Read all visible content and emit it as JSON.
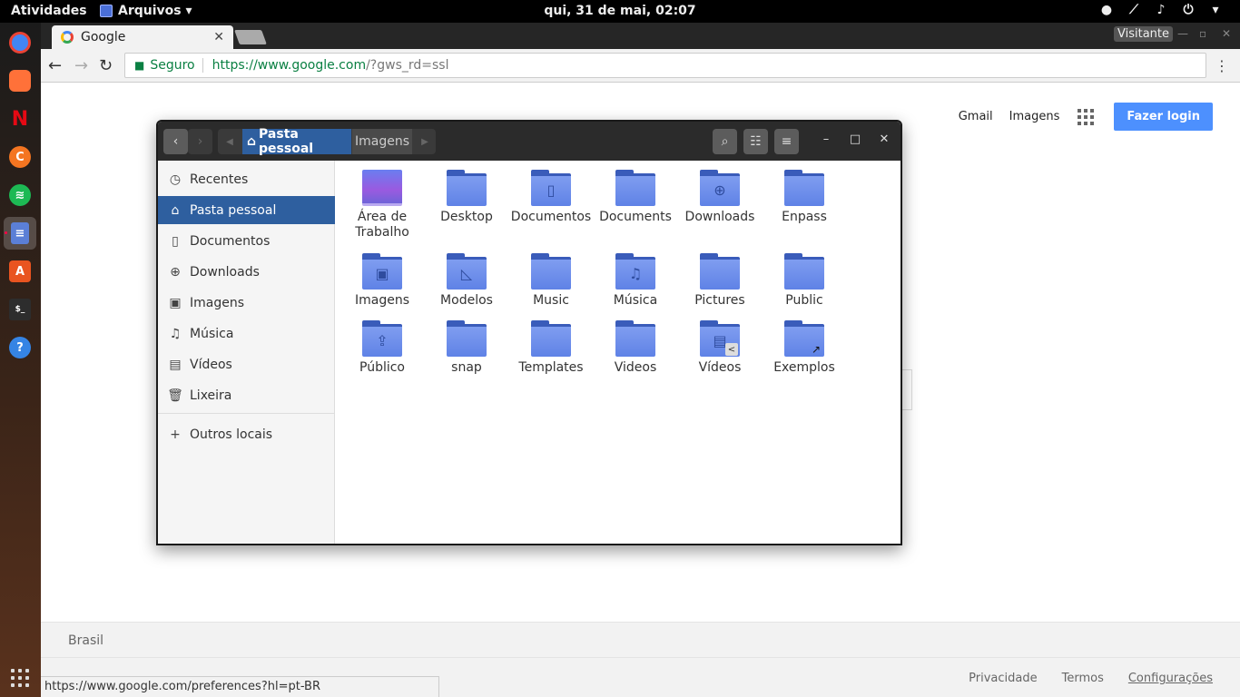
{
  "topbar": {
    "activities": "Atividades",
    "app_menu": "Arquivos ▾",
    "clock": "qui, 31 de mai, 02:07"
  },
  "dock": {
    "apps": [
      {
        "name": "chrome-icon",
        "color": "#4285f4"
      },
      {
        "name": "firefox-icon",
        "color": "#ff7139"
      },
      {
        "name": "netflix-icon",
        "color": "#e50914"
      },
      {
        "name": "crunchyroll-icon",
        "color": "#f47521"
      },
      {
        "name": "spotify-icon",
        "color": "#1db954"
      },
      {
        "name": "files-icon",
        "color": "#5b7fd6"
      },
      {
        "name": "software-center-icon",
        "color": "#e95420"
      },
      {
        "name": "terminal-icon",
        "color": "#2d2d2d"
      },
      {
        "name": "help-icon",
        "color": "#3584e4"
      }
    ]
  },
  "browser": {
    "tab_title": "Google",
    "profile": "Visitante",
    "omnibox": {
      "secure_label": "Seguro",
      "url_main": "https://www.google.com",
      "url_rest": "/?gws_rd=ssl"
    }
  },
  "google": {
    "links": [
      "Gmail",
      "Imagens"
    ],
    "login": "Fazer login",
    "country": "Brasil",
    "footer_right": [
      "Privacidade",
      "Termos",
      "Configurações"
    ],
    "status_url": "https://www.google.com/preferences?hl=pt-BR"
  },
  "files": {
    "path": {
      "home": "Pasta pessoal",
      "current": "Imagens"
    },
    "sidebar": [
      {
        "label": "Recentes",
        "icon": "clock-icon"
      },
      {
        "label": "Pasta pessoal",
        "icon": "home-icon",
        "selected": true
      },
      {
        "label": "Documentos",
        "icon": "document-icon"
      },
      {
        "label": "Downloads",
        "icon": "download-icon"
      },
      {
        "label": "Imagens",
        "icon": "image-icon"
      },
      {
        "label": "Música",
        "icon": "music-icon"
      },
      {
        "label": "Vídeos",
        "icon": "video-icon"
      },
      {
        "label": "Lixeira",
        "icon": "trash-icon"
      }
    ],
    "other_locations": "Outros locais",
    "items": [
      {
        "label": "Área de Trabalho",
        "type": "desktop"
      },
      {
        "label": "Desktop",
        "type": "folder"
      },
      {
        "label": "Documentos",
        "type": "folder",
        "emblem": "document"
      },
      {
        "label": "Documents",
        "type": "folder"
      },
      {
        "label": "Downloads",
        "type": "folder",
        "emblem": "download"
      },
      {
        "label": "Enpass",
        "type": "folder"
      },
      {
        "label": "Imagens",
        "type": "folder",
        "emblem": "image"
      },
      {
        "label": "Modelos",
        "type": "folder",
        "emblem": "template"
      },
      {
        "label": "Music",
        "type": "folder"
      },
      {
        "label": "Música",
        "type": "folder",
        "emblem": "music"
      },
      {
        "label": "Pictures",
        "type": "folder"
      },
      {
        "label": "Public",
        "type": "folder"
      },
      {
        "label": "Público",
        "type": "folder",
        "emblem": "public"
      },
      {
        "label": "snap",
        "type": "folder"
      },
      {
        "label": "Templates",
        "type": "folder"
      },
      {
        "label": "Videos",
        "type": "folder"
      },
      {
        "label": "Vídeos",
        "type": "folder",
        "emblem": "video",
        "badge": "share"
      },
      {
        "label": "Exemplos",
        "type": "folder",
        "badge": "link"
      }
    ]
  }
}
